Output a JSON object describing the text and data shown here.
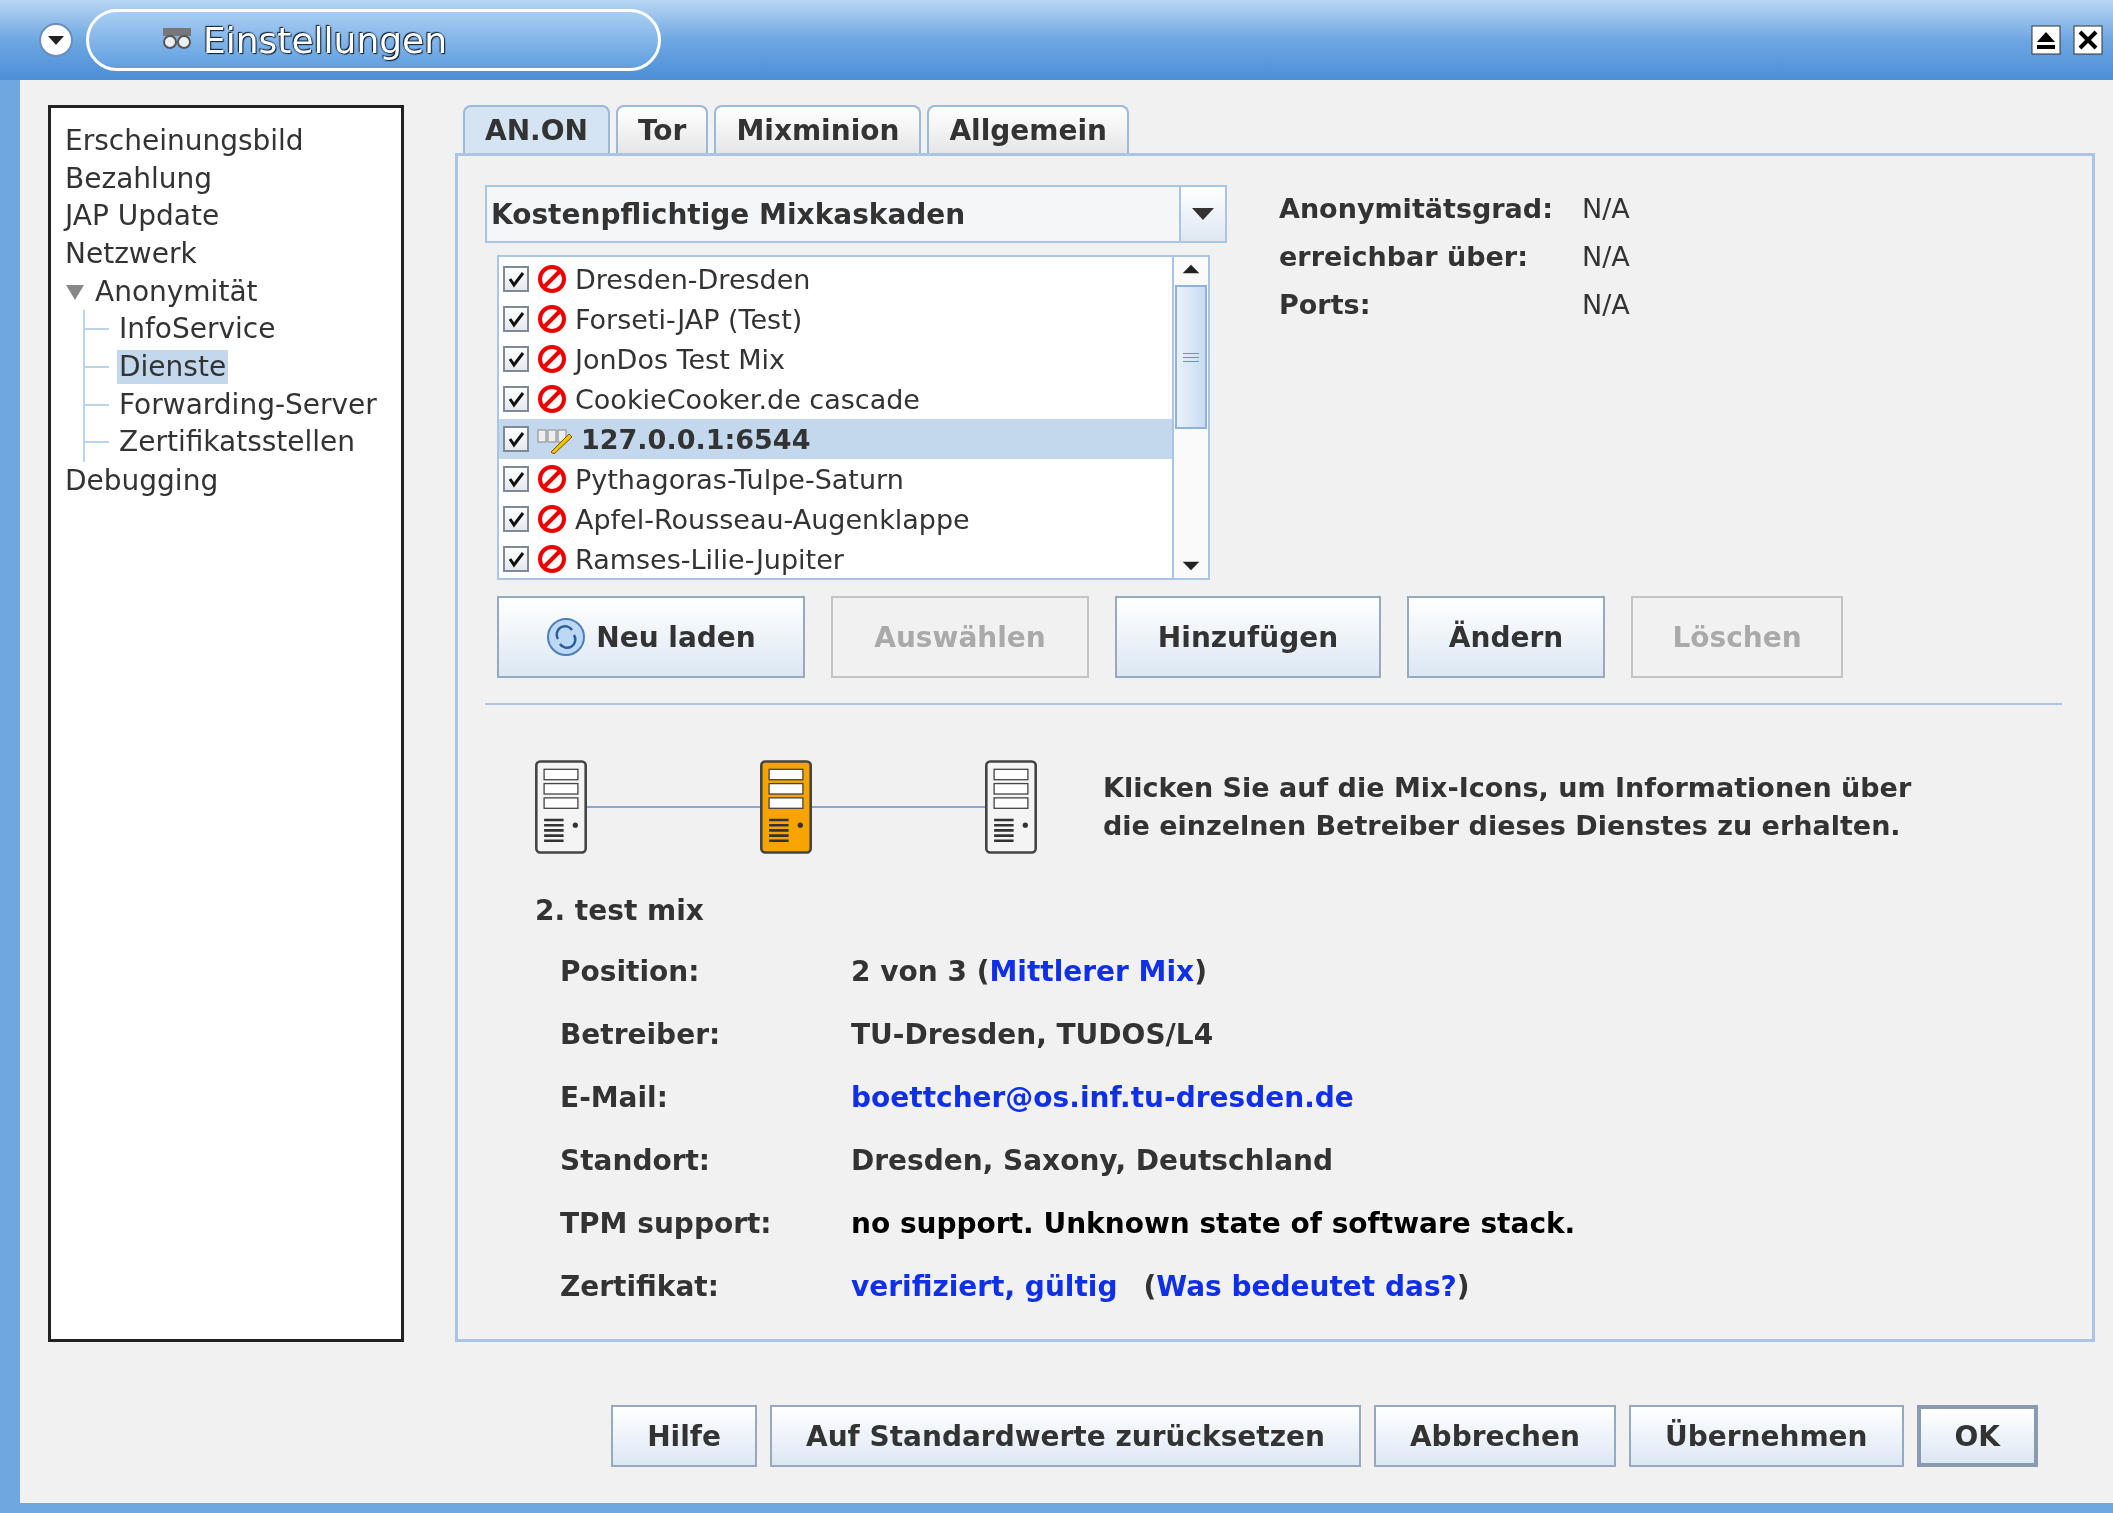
{
  "window": {
    "title": "Einstellungen"
  },
  "sidebar": {
    "items": [
      {
        "label": "Erscheinungsbild",
        "selected": false
      },
      {
        "label": "Bezahlung",
        "selected": false
      },
      {
        "label": "JAP Update",
        "selected": false
      },
      {
        "label": "Netzwerk",
        "selected": false
      },
      {
        "label": "Anonymität",
        "selected": false,
        "expanded": true,
        "children": [
          {
            "label": "InfoService",
            "selected": false
          },
          {
            "label": "Dienste",
            "selected": true
          },
          {
            "label": "Forwarding-Server",
            "selected": false
          },
          {
            "label": "Zertifikatsstellen",
            "selected": false
          }
        ]
      },
      {
        "label": "Debugging",
        "selected": false
      }
    ]
  },
  "tabs": [
    {
      "label": "AN.ON",
      "selected": true
    },
    {
      "label": "Tor",
      "selected": false
    },
    {
      "label": "Mixminion",
      "selected": false
    },
    {
      "label": "Allgemein",
      "selected": false
    }
  ],
  "cascade_filter": {
    "value": "Kostenpflichtige Mixkaskaden"
  },
  "cascades": [
    {
      "name": "Dresden-Dresden",
      "checked": true,
      "selected": false,
      "kind": "blocked"
    },
    {
      "name": "Forseti-JAP (Test)",
      "checked": true,
      "selected": false,
      "kind": "blocked"
    },
    {
      "name": "JonDos Test Mix",
      "checked": true,
      "selected": false,
      "kind": "blocked"
    },
    {
      "name": "CookieCooker.de cascade",
      "checked": true,
      "selected": false,
      "kind": "blocked"
    },
    {
      "name": "127.0.0.1:6544",
      "checked": true,
      "selected": true,
      "kind": "custom"
    },
    {
      "name": "Pythagoras-Tulpe-Saturn",
      "checked": true,
      "selected": false,
      "kind": "blocked"
    },
    {
      "name": "Apfel-Rousseau-Augenklappe",
      "checked": true,
      "selected": false,
      "kind": "blocked"
    },
    {
      "name": "Ramses-Lilie-Jupiter",
      "checked": true,
      "selected": false,
      "kind": "blocked"
    }
  ],
  "cascade_info": [
    {
      "label": "Anonymitätsgrad:",
      "value": "N/A"
    },
    {
      "label": "erreichbar über:",
      "value": "N/A"
    },
    {
      "label": "Ports:",
      "value": "N/A"
    }
  ],
  "cascade_buttons": [
    {
      "label": "Neu laden",
      "disabled": false,
      "kind": "reload"
    },
    {
      "label": "Auswählen",
      "disabled": true,
      "kind": "plain"
    },
    {
      "label": "Hinzufügen",
      "disabled": false,
      "kind": "plain"
    },
    {
      "label": "Ändern",
      "disabled": false,
      "kind": "plain"
    },
    {
      "label": "Löschen",
      "disabled": true,
      "kind": "plain"
    }
  ],
  "mix_chain": {
    "mixes": [
      {
        "selected": false
      },
      {
        "selected": true
      },
      {
        "selected": false
      }
    ],
    "hint": "Klicken Sie auf die Mix-Icons, um Informationen über die einzelnen Betreiber dieses Dienstes zu erhalten."
  },
  "mix_details": {
    "title": "2. test mix",
    "rows": [
      {
        "label": "Position:",
        "parts": [
          {
            "text": "2 von 3 (",
            "kind": "text"
          },
          {
            "text": "Mittlerer Mix",
            "kind": "link"
          },
          {
            "text": ")",
            "kind": "text"
          }
        ]
      },
      {
        "label": "Betreiber:",
        "parts": [
          {
            "text": "TU-Dresden, TUDOS/L4",
            "kind": "text"
          }
        ]
      },
      {
        "label": "E-Mail:",
        "parts": [
          {
            "text": "boettcher@os.inf.tu-dresden.de",
            "kind": "link"
          }
        ]
      },
      {
        "label": "Standort:",
        "parts": [
          {
            "text": "Dresden, Saxony, Deutschland",
            "kind": "text"
          }
        ]
      },
      {
        "label": "TPM support:",
        "parts": [
          {
            "text": "no support. Unknown state of software stack.",
            "kind": "strong"
          }
        ]
      },
      {
        "label": "Zertifikat:",
        "parts": [
          {
            "text": "verifiziert, gültig",
            "kind": "link"
          },
          {
            "text": "(",
            "kind": "text"
          },
          {
            "text": "Was bedeutet das?",
            "kind": "link"
          },
          {
            "text": ")",
            "kind": "text"
          }
        ]
      }
    ]
  },
  "footer_buttons": [
    {
      "label": "Hilfe",
      "default": false
    },
    {
      "label": "Auf Standardwerte zurücksetzen",
      "default": false
    },
    {
      "label": "Abbrechen",
      "default": false
    },
    {
      "label": "Übernehmen",
      "default": false
    },
    {
      "label": "OK",
      "default": true
    }
  ]
}
